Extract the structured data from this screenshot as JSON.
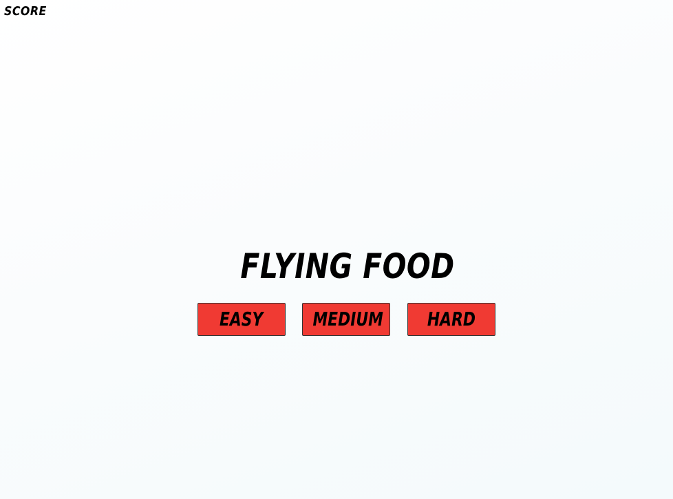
{
  "hud": {
    "score_label": "SCORE"
  },
  "menu": {
    "title": "FLYING FOOD",
    "buttons": [
      {
        "label": "EASY"
      },
      {
        "label": "MEDIUM"
      },
      {
        "label": "HARD"
      }
    ]
  },
  "colors": {
    "button_background": "#f03a33",
    "text": "#000000",
    "background": "#f7fbfc"
  }
}
